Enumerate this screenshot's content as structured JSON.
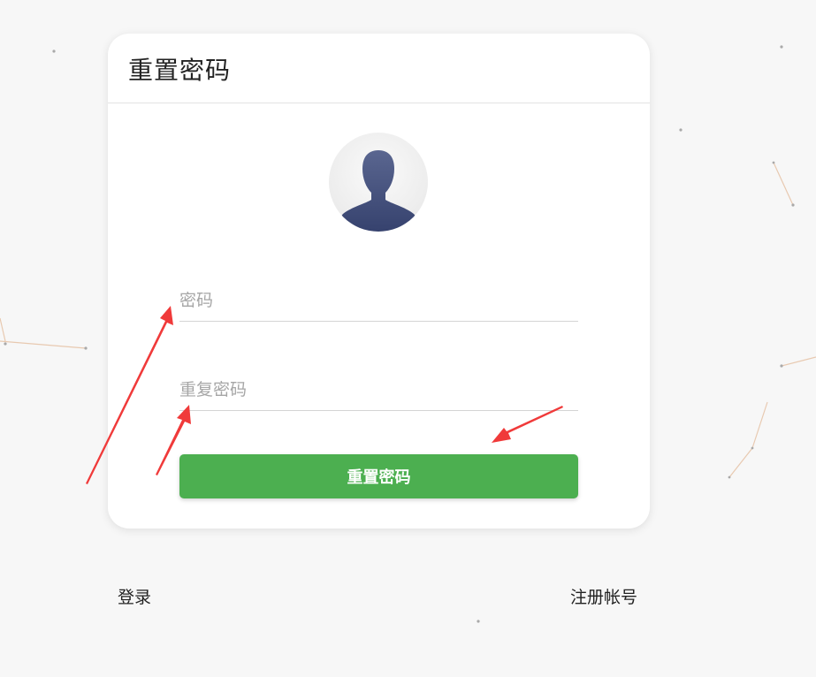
{
  "card": {
    "title": "重置密码"
  },
  "form": {
    "password_placeholder": "密码",
    "repeat_password_placeholder": "重复密码",
    "submit_label": "重置密码"
  },
  "footer": {
    "login_label": "登录",
    "register_label": "注册帐号"
  },
  "icons": {
    "avatar": "default-user-silhouette"
  },
  "colors": {
    "background": "#f7f7f7",
    "card": "#ffffff",
    "submit_button": "#4caf50",
    "annotation_arrow": "#f03a3a",
    "avatar_silhouette": "#3f4d7a"
  }
}
